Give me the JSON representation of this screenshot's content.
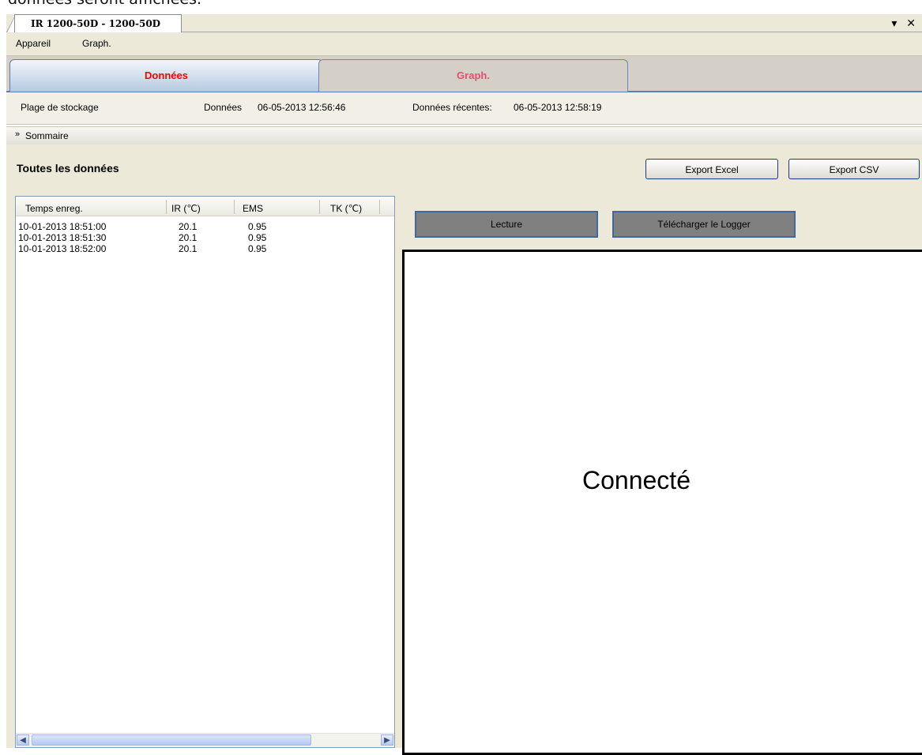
{
  "top_text": "données seront affichées.",
  "document_tab": {
    "title": "IR 1200-50D - 1200-50D",
    "controls": "▾ ✕"
  },
  "menu": {
    "items": [
      "Appareil",
      "Graph."
    ]
  },
  "tabs": [
    {
      "label": "Données",
      "active": true
    },
    {
      "label": "Graph.",
      "active": false
    }
  ],
  "info": {
    "storage_label": "Plage de stockage",
    "data_label": "Données",
    "data_value": "06-05-2013 12:56:46",
    "recent_label": "Données récentes:",
    "recent_value": "06-05-2013 12:58:19"
  },
  "summary": {
    "icon": "double-chevron-down-icon",
    "label": "Sommaire"
  },
  "section_title": "Toutes les données",
  "buttons": {
    "export_excel": "Export Excel",
    "export_csv": "Export CSV",
    "read": "Lecture",
    "download": "Télécharger le Logger"
  },
  "table": {
    "columns": [
      "Temps enreg.",
      "IR (℃)",
      "EMS",
      "TK (℃)"
    ],
    "rows": [
      [
        "10-01-2013 18:51:00",
        "20.1",
        "0.95",
        ""
      ],
      [
        "10-01-2013 18:51:30",
        "20.1",
        "0.95",
        ""
      ],
      [
        "10-01-2013 18:52:00",
        "20.1",
        "0.95",
        ""
      ]
    ]
  },
  "status_text": "Connecté",
  "colors": {
    "active_tab_text": "#ff0000",
    "inactive_tab_text": "#ea4d6c",
    "accent_border": "#3d6aa3",
    "button_fill": "#808080"
  }
}
